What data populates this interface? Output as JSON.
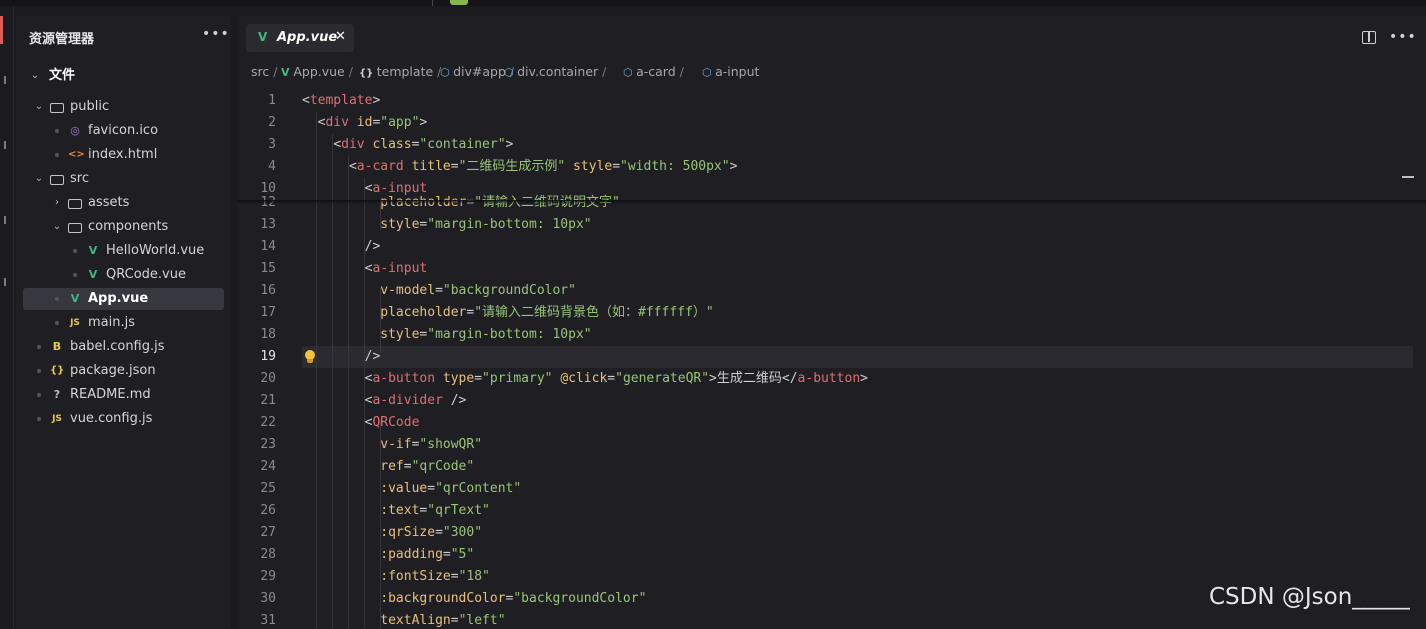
{
  "explorer": {
    "title": "资源管理器",
    "more_icon": "ellipsis-icon",
    "section_label": "文件",
    "tree": [
      {
        "label": "public",
        "type": "folder",
        "level": 0,
        "expanded": true
      },
      {
        "label": "favicon.ico",
        "type": "ico",
        "level": 1
      },
      {
        "label": "index.html",
        "type": "html",
        "level": 1
      },
      {
        "label": "src",
        "type": "folder",
        "level": 0,
        "expanded": true
      },
      {
        "label": "assets",
        "type": "folder",
        "level": 1,
        "expanded": false
      },
      {
        "label": "components",
        "type": "folder",
        "level": 1,
        "expanded": true
      },
      {
        "label": "HelloWorld.vue",
        "type": "vue",
        "level": 2
      },
      {
        "label": "QRCode.vue",
        "type": "vue",
        "level": 2
      },
      {
        "label": "App.vue",
        "type": "vue",
        "level": 1,
        "selected": true
      },
      {
        "label": "main.js",
        "type": "js",
        "level": 1
      },
      {
        "label": "babel.config.js",
        "type": "babel",
        "level": 0
      },
      {
        "label": "package.json",
        "type": "json",
        "level": 0
      },
      {
        "label": "README.md",
        "type": "md",
        "level": 0
      },
      {
        "label": "vue.config.js",
        "type": "js",
        "level": 0
      }
    ]
  },
  "tab": {
    "label": "App.vue",
    "close_glyph": "✕"
  },
  "breadcrumb": [
    "src",
    "App.vue",
    "template",
    "div#app",
    "div.container",
    "a-card",
    "a-input"
  ],
  "breadcrumb_sep": "/",
  "code_lines": [
    {
      "n": "1",
      "text": "<template>"
    },
    {
      "n": "2",
      "text": "  <div id=\"app\">"
    },
    {
      "n": "3",
      "text": "    <div class=\"container\">"
    },
    {
      "n": "4",
      "text": "      <a-card title=\"二维码生成示例\" style=\"width: 500px\">"
    },
    {
      "n": "10",
      "text": "        <a-input"
    },
    {
      "n": "12",
      "text": "          placeholder=\"请输入二维码说明文字\""
    },
    {
      "n": "13",
      "text": "          style=\"margin-bottom: 10px\""
    },
    {
      "n": "14",
      "text": "        />"
    },
    {
      "n": "15",
      "text": "        <a-input"
    },
    {
      "n": "16",
      "text": "          v-model=\"backgroundColor\""
    },
    {
      "n": "17",
      "text": "          placeholder=\"请输入二维码背景色（如：#ffffff）\""
    },
    {
      "n": "18",
      "text": "          style=\"margin-bottom: 10px\""
    },
    {
      "n": "19",
      "text": "        />"
    },
    {
      "n": "20",
      "text": "        <a-button type=\"primary\" @click=\"generateQR\">生成二维码</a-button>"
    },
    {
      "n": "21",
      "text": "        <a-divider />"
    },
    {
      "n": "22",
      "text": "        <QRCode"
    },
    {
      "n": "23",
      "text": "          v-if=\"showQR\""
    },
    {
      "n": "24",
      "text": "          ref=\"qrCode\""
    },
    {
      "n": "25",
      "text": "          :value=\"qrContent\""
    },
    {
      "n": "26",
      "text": "          :text=\"qrText\""
    },
    {
      "n": "27",
      "text": "          :qrSize=\"300\""
    },
    {
      "n": "28",
      "text": "          :padding=\"5\""
    },
    {
      "n": "29",
      "text": "          :fontSize=\"18\""
    },
    {
      "n": "30",
      "text": "          :backgroundColor=\"backgroundColor\""
    },
    {
      "n": "31",
      "text": "          textAlign=\"left\""
    }
  ],
  "current_line": "19",
  "watermark": "CSDN @Json_____",
  "colors": {
    "tag": "#e06c75",
    "attr": "#e5c07b",
    "string": "#98c379",
    "vue": "#41b883"
  }
}
